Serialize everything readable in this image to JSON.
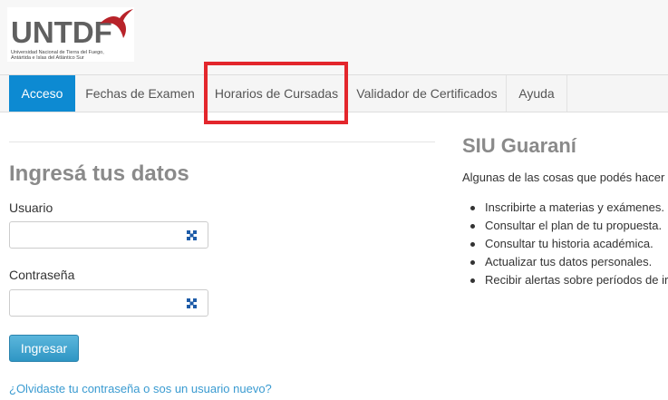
{
  "header": {
    "logo": {
      "name": "UNTDF",
      "subtitle": "Universidad Nacional de Tierra del Fuego, Antártida e Islas del Atlántico Sur",
      "icon": "bird-icon"
    }
  },
  "nav": {
    "items": [
      {
        "label": "Acceso",
        "active": true
      },
      {
        "label": "Fechas de Examen",
        "active": false
      },
      {
        "label": "Horarios de Cursadas",
        "active": false
      },
      {
        "label": "Validador de Certificados",
        "active": false
      },
      {
        "label": "Ayuda",
        "active": false
      }
    ]
  },
  "login": {
    "title": "Ingresá tus datos",
    "user_label": "Usuario",
    "user_value": "",
    "password_label": "Contraseña",
    "password_value": "",
    "field_icon": "password-manager-icon",
    "submit_label": "Ingresar",
    "forgot_link": "¿Olvidaste tu contraseña o sos un usuario nuevo?"
  },
  "info": {
    "title": "SIU Guaraní",
    "intro": "Algunas de las cosas que podés hacer",
    "items": [
      "Inscribirte a materias y exámenes.",
      "Consultar el plan de tu propuesta.",
      "Consultar tu historia académica.",
      "Actualizar tus datos personales.",
      "Recibir alertas sobre períodos de ir"
    ]
  },
  "colors": {
    "nav_active": "#0d8ad2",
    "highlight": "#e3262c",
    "button": "#3fa5cf",
    "link": "#3a9bd1"
  }
}
